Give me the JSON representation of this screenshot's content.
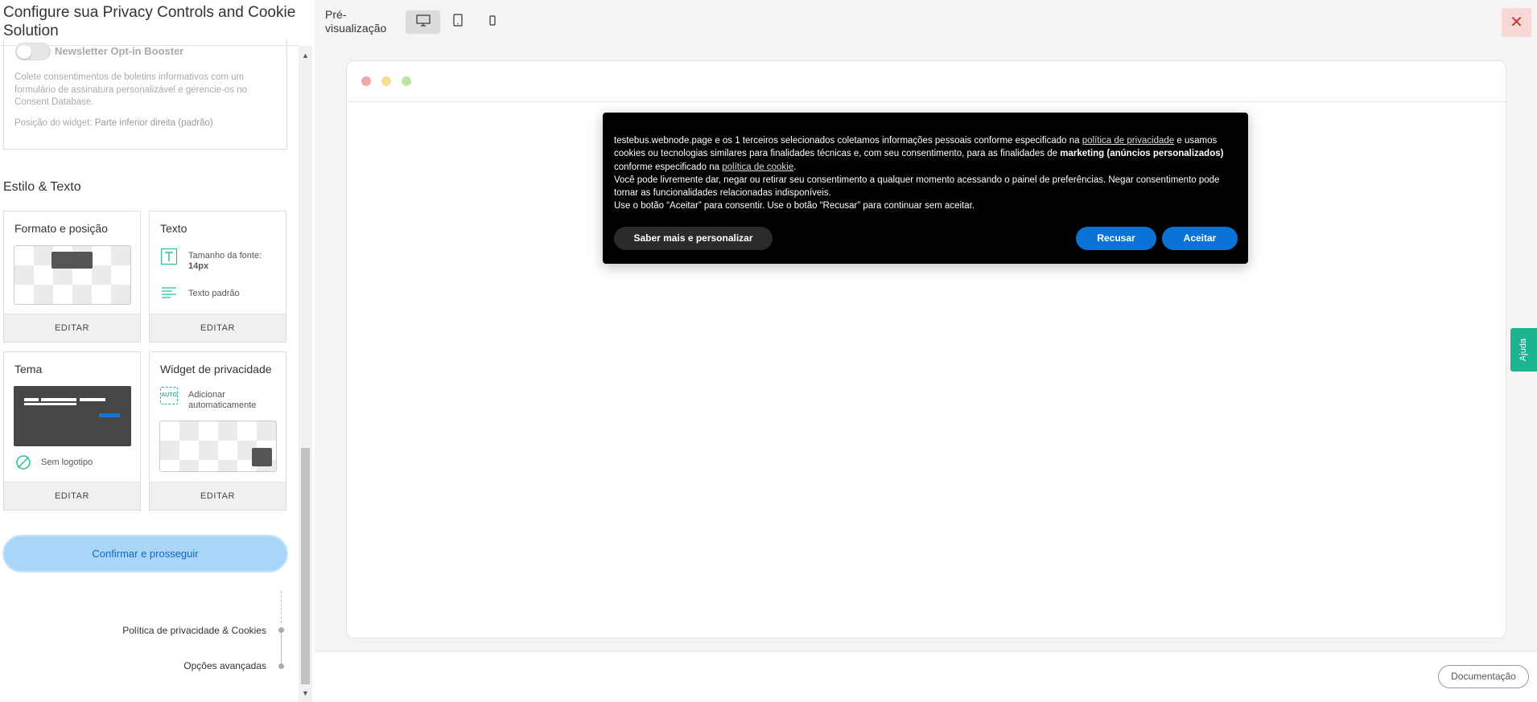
{
  "left_panel": {
    "title": "Configure sua Privacy Controls and Cookie Solution",
    "newsletter": {
      "toggle_label": "Newsletter Opt-in Booster",
      "toggle_on": false,
      "description": "Colete consentimentos de boletins informativos com um formulário de assinatura personalizável e gerencie-os no Consent Database.",
      "position_label": "Posição do widget:",
      "position_value": "Parte inferior direita (padrão)"
    },
    "section_title": "Estilo & Texto",
    "cards": {
      "format": {
        "title": "Formato e posição",
        "edit": "EDITAR"
      },
      "text": {
        "title": "Texto",
        "font_size_label": "Tamanho da fonte:",
        "font_size_value": "14px",
        "default_text": "Texto padrão",
        "edit": "EDITAR"
      },
      "theme": {
        "title": "Tema",
        "logo_label": "Sem logotipo",
        "edit": "EDITAR"
      },
      "widget": {
        "title": "Widget de privacidade",
        "auto_label": "Adicionar automaticamente",
        "auto_badge": "AUTO",
        "edit": "EDITAR"
      }
    },
    "confirm_button": "Confirmar e prosseguir",
    "steps": [
      "Política de privacidade & Cookies",
      "Opções avançadas"
    ]
  },
  "preview": {
    "label": "Pré-visualização",
    "devices": [
      "desktop-icon",
      "tablet-icon",
      "mobile-icon"
    ],
    "selected_device": "desktop",
    "close_symbol": "✕",
    "banner": {
      "p1_a": "testebus.webnode.page e os 1 terceiros selecionados coletamos informações pessoais conforme especificado na ",
      "p1_link1": "política de privacidade",
      "p1_b": " e usamos cookies ou tecnologias similares para finalidades técnicas e, com seu consentimento, para as finalidades de ",
      "p1_bold": "marketing (anúncios personalizados)",
      "p1_c": " conforme especificado na ",
      "p1_link2": "política de cookie",
      "p1_d": ".",
      "p2": "Você pode livremente dar, negar ou retirar seu consentimento a qualquer momento acessando o painel de preferências. Negar consentimento pode tornar as funcionalidades relacionadas indisponíveis.",
      "p3": "Use o botão “Aceitar” para consentir. Use o botão “Recusar” para continuar sem aceitar.",
      "btn_more": "Saber mais e personalizar",
      "btn_reject": "Recusar",
      "btn_accept": "Aceitar"
    },
    "help_tab": "Ajuda",
    "doc_button": "Documentação"
  },
  "colors": {
    "accent_blue": "#0a73d5",
    "confirm_bg": "#a9d5f8",
    "help_green": "#1cb58f",
    "icon_green": "#2bbf8f",
    "close_red": "#c0392b"
  }
}
